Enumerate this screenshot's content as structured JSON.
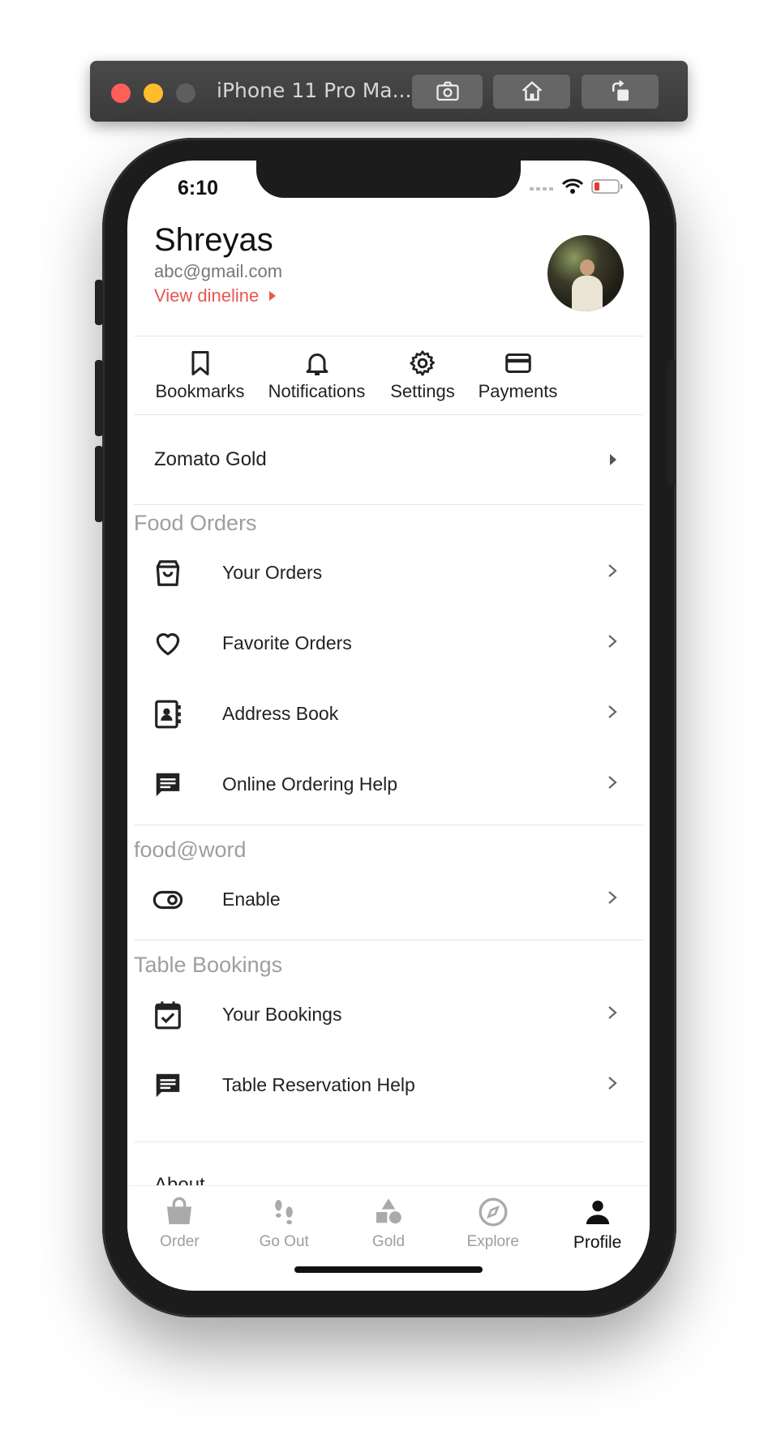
{
  "simulator": {
    "title": "iPhone 11 Pro Ma...",
    "buttons": [
      "screenshot-icon",
      "home-icon",
      "rotate-icon"
    ]
  },
  "status_bar": {
    "time": "6:10",
    "icons": [
      "signal-icon",
      "wifi-icon",
      "battery-low-icon"
    ],
    "battery_color": "#e53935"
  },
  "profile": {
    "name": "Shreyas",
    "email": "abc@gmail.com",
    "view_link": "View dineline",
    "accent": "#e8574f"
  },
  "quick_actions": [
    {
      "label": "Bookmarks",
      "icon": "bookmark-icon"
    },
    {
      "label": "Notifications",
      "icon": "bell-icon"
    },
    {
      "label": "Settings",
      "icon": "gear-icon"
    },
    {
      "label": "Payments",
      "icon": "credit-card-icon"
    }
  ],
  "gold": {
    "label": "Zomato Gold"
  },
  "sections": {
    "food_orders": {
      "title": "Food Orders",
      "items": [
        {
          "label": "Your Orders",
          "icon": "shopping-bag-icon"
        },
        {
          "label": "Favorite Orders",
          "icon": "heart-icon"
        },
        {
          "label": "Address Book",
          "icon": "contact-book-icon"
        },
        {
          "label": "Online Ordering Help",
          "icon": "chat-icon"
        }
      ]
    },
    "foodaword": {
      "title": "food@word",
      "items": [
        {
          "label": "Enable",
          "icon": "toggle-icon"
        }
      ]
    },
    "table_bookings": {
      "title": "Table Bookings",
      "items": [
        {
          "label": "Your Bookings",
          "icon": "calendar-check-icon"
        },
        {
          "label": "Table Reservation Help",
          "icon": "chat-icon"
        }
      ]
    },
    "about": {
      "label": "About"
    }
  },
  "tabs": [
    {
      "label": "Order",
      "icon": "bag-icon",
      "active": false
    },
    {
      "label": "Go Out",
      "icon": "footsteps-icon",
      "active": false
    },
    {
      "label": "Gold",
      "icon": "shapes-icon",
      "active": false
    },
    {
      "label": "Explore",
      "icon": "compass-icon",
      "active": false
    },
    {
      "label": "Profile",
      "icon": "person-icon",
      "active": true
    }
  ]
}
